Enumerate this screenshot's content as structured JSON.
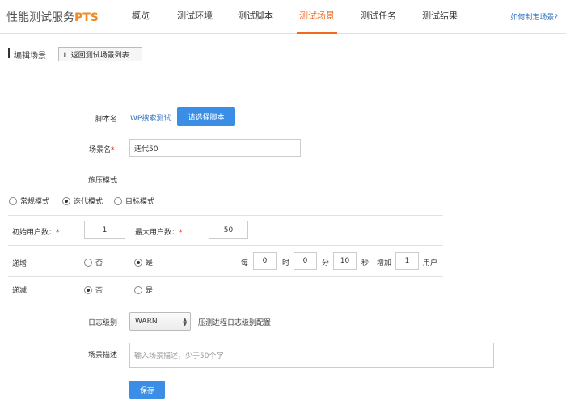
{
  "header": {
    "brand_text": "性能测试服务",
    "brand_suffix": "PTS",
    "nav": [
      "概览",
      "测试环境",
      "测试脚本",
      "测试场景",
      "测试任务",
      "测试结果"
    ],
    "active_nav": "测试场景",
    "help_link": "如何制定场景?"
  },
  "section": {
    "title": "编辑场景",
    "back_label": "返回测试场景列表"
  },
  "form": {
    "script_label": "脚本名",
    "script_value": "WP搜索测试",
    "choose_script_label": "请选择脚本",
    "scene_name_label": "场景名",
    "required_mark": "*",
    "scene_name_value": "迭代50",
    "pressure_mode_label": "施压模式",
    "modes": [
      "常规模式",
      "迭代模式",
      "目标模式"
    ],
    "selected_mode": "迭代模式",
    "initial_users_label": "初始用户数：",
    "initial_users_value": "1",
    "max_users_label": "最大用户数：",
    "max_users_value": "50",
    "ramp_up_label": "递增",
    "ramp_up_options": [
      "否",
      "是"
    ],
    "ramp_up_selected": "是",
    "ramp_text": {
      "every": "每",
      "hour_value": "0",
      "hour_unit": "时",
      "minute_value": "0",
      "minute_unit": "分",
      "second_value": "10",
      "second_unit": "秒",
      "increase": "增加",
      "increase_value": "1",
      "user_unit": "用户"
    },
    "ramp_down_label": "递减",
    "ramp_down_options": [
      "否",
      "是"
    ],
    "ramp_down_selected": "否",
    "log_level_label": "日志级别",
    "log_level_value": "WARN",
    "log_level_hint": "压测进程日志级别配置",
    "description_label": "场景描述",
    "description_placeholder": "输入场景描述，少于50个字",
    "save_label": "保存"
  },
  "colors": {
    "accent": "#f06a1c",
    "primary_button": "#3a8ee6",
    "link": "#2e6dbb",
    "required": "#d9342b"
  }
}
